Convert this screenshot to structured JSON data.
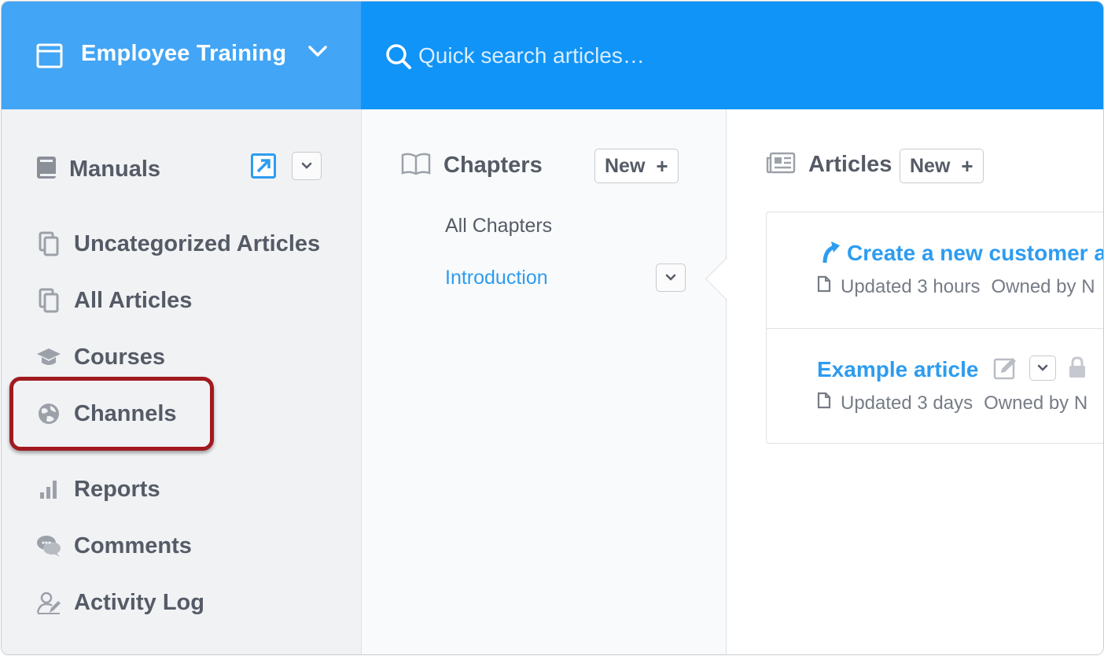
{
  "header": {
    "workspace_title": "Employee Training",
    "search_placeholder": "Quick search articles…"
  },
  "sidebar": {
    "section_label": "Manuals",
    "items": [
      {
        "label": "Uncategorized Articles",
        "icon": "copy-icon"
      },
      {
        "label": "All Articles",
        "icon": "copy-icon"
      },
      {
        "label": "Courses",
        "icon": "graduation-cap-icon"
      },
      {
        "label": "Channels",
        "icon": "globe-icon"
      },
      {
        "label": "Reports",
        "icon": "bar-chart-icon"
      },
      {
        "label": "Comments",
        "icon": "chat-bubbles-icon"
      },
      {
        "label": "Activity Log",
        "icon": "user-edit-icon"
      }
    ],
    "highlighted_item": "Channels"
  },
  "chapters": {
    "title": "Chapters",
    "new_label": "New",
    "links": [
      {
        "label": "All Chapters",
        "active": false
      },
      {
        "label": "Introduction",
        "active": true
      }
    ]
  },
  "articles": {
    "title": "Articles",
    "new_label": "New",
    "items": [
      {
        "title": "Create a new customer a",
        "updated": "Updated 3 hours",
        "owner": "Owned by N"
      },
      {
        "title": "Example article",
        "updated": "Updated 3 days",
        "owner": "Owned by N"
      }
    ]
  },
  "colors": {
    "brand_blue": "#42a5f5",
    "topbar_blue": "#1094f7",
    "link_blue": "#2d9cf0",
    "highlight_red": "#a11a1f"
  }
}
